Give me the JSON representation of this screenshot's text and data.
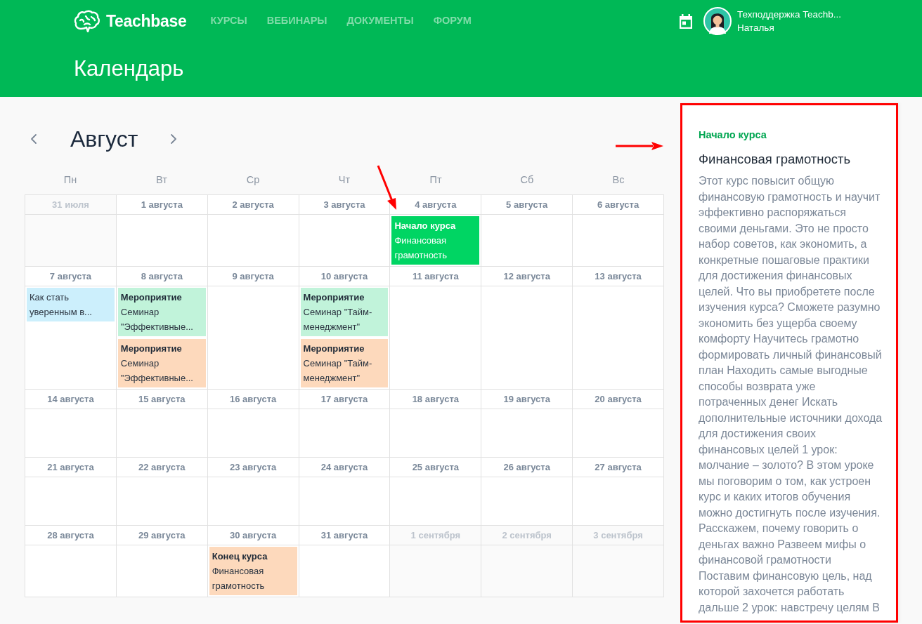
{
  "header": {
    "logo": "Teachbase",
    "nav": [
      "КУРСЫ",
      "ВЕБИНАРЫ",
      "ДОКУМЕНТЫ",
      "ФОРУМ"
    ],
    "user": {
      "name": "Техподдержка Teachb...",
      "subtitle": "Наталья"
    }
  },
  "page_title": "Календарь",
  "calendar": {
    "month": "Август",
    "weekdays": [
      "Пн",
      "Вт",
      "Ср",
      "Чт",
      "Пт",
      "Сб",
      "Вс"
    ],
    "weeks": [
      {
        "days": [
          {
            "date": "31 июля",
            "in_month": false
          },
          {
            "date": "1 августа",
            "in_month": true
          },
          {
            "date": "2 августа",
            "in_month": true
          },
          {
            "date": "3 августа",
            "in_month": true
          },
          {
            "date": "4 августа",
            "in_month": true,
            "events": [
              {
                "title": "Начало курса",
                "text": "Финансовая грамотность",
                "color": "#00d563",
                "annotation": {
                  "kind": "arrow"
                }
              }
            ]
          },
          {
            "date": "5 августа",
            "in_month": true
          },
          {
            "date": "6 августа",
            "in_month": true
          }
        ]
      },
      {
        "days": [
          {
            "date": "7 августа",
            "in_month": true,
            "events": [
              {
                "text": "Как стать уверенным в...",
                "color": "#cceffc"
              }
            ]
          },
          {
            "date": "8 августа",
            "in_month": true,
            "events": [
              {
                "title": "Мероприятие",
                "text": "Семинар \"Эффективные...",
                "color": "#c1f3da"
              },
              {
                "title": "Мероприятие",
                "text": "Семинар \"Эффективные...",
                "color": "#fdd9bc"
              }
            ]
          },
          {
            "date": "9 августа",
            "in_month": true
          },
          {
            "date": "10 августа",
            "in_month": true,
            "events": [
              {
                "title": "Мероприятие",
                "text": "Семинар \"Тайм-менеджмент\"",
                "color": "#c1f3da"
              },
              {
                "title": "Мероприятие",
                "text": "Семинар \"Тайм-менеджмент\"",
                "color": "#fdd9bc"
              }
            ]
          },
          {
            "date": "11 августа",
            "in_month": true
          },
          {
            "date": "12 августа",
            "in_month": true
          },
          {
            "date": "13 августа",
            "in_month": true
          }
        ]
      },
      {
        "days": [
          {
            "date": "14 августа",
            "in_month": true
          },
          {
            "date": "15 августа",
            "in_month": true
          },
          {
            "date": "16 августа",
            "in_month": true
          },
          {
            "date": "17 августа",
            "in_month": true
          },
          {
            "date": "18 августа",
            "in_month": true
          },
          {
            "date": "19 августа",
            "in_month": true
          },
          {
            "date": "20 августа",
            "in_month": true
          }
        ]
      },
      {
        "days": [
          {
            "date": "21 августа",
            "in_month": true
          },
          {
            "date": "22 августа",
            "in_month": true
          },
          {
            "date": "23 августа",
            "in_month": true
          },
          {
            "date": "24 августа",
            "in_month": true
          },
          {
            "date": "25 августа",
            "in_month": true
          },
          {
            "date": "26 августа",
            "in_month": true
          },
          {
            "date": "27 августа",
            "in_month": true
          }
        ]
      },
      {
        "days": [
          {
            "date": "28 августа",
            "in_month": true
          },
          {
            "date": "29 августа",
            "in_month": true
          },
          {
            "date": "30 августа",
            "in_month": true,
            "events": [
              {
                "title": "Конец курса",
                "text": "Финансовая грамотность",
                "color": "#fdd9bc"
              }
            ]
          },
          {
            "date": "31 августа",
            "in_month": true
          },
          {
            "date": "1 сентября",
            "in_month": false
          },
          {
            "date": "2 сентября",
            "in_month": false
          },
          {
            "date": "3 сентября",
            "in_month": false
          }
        ]
      }
    ]
  },
  "details": {
    "label": "Начало курса",
    "title": "Финансовая грамотность",
    "description": "Этот курс повысит общую финансовую грамотность и научит эффективно распоряжаться своими деньгами. Это не просто набор советов, как экономить, а конкретные пошаговые практики для достижения финансовых целей. Что вы приобретете после изучения курса? Сможете разумно экономить без ущерба своему комфорту Научитесь грамотно формировать личный финансовый план Находить самые выгодные способы возврата уже потраченных денег Искать дополнительные источники дохода для достижения своих финансовых целей 1 урок: молчание – золото? В этом уроке мы поговорим о том, как устроен курс и каких итогов обучения можно достигнуть после изучения. Расскажем, почему говорить о деньгах важно Развеем мифы о финансовой грамотности Поставим финансовую цель, над которой захочется работать дальше 2 урок: навстречу целям В",
    "highlighted": true
  }
}
